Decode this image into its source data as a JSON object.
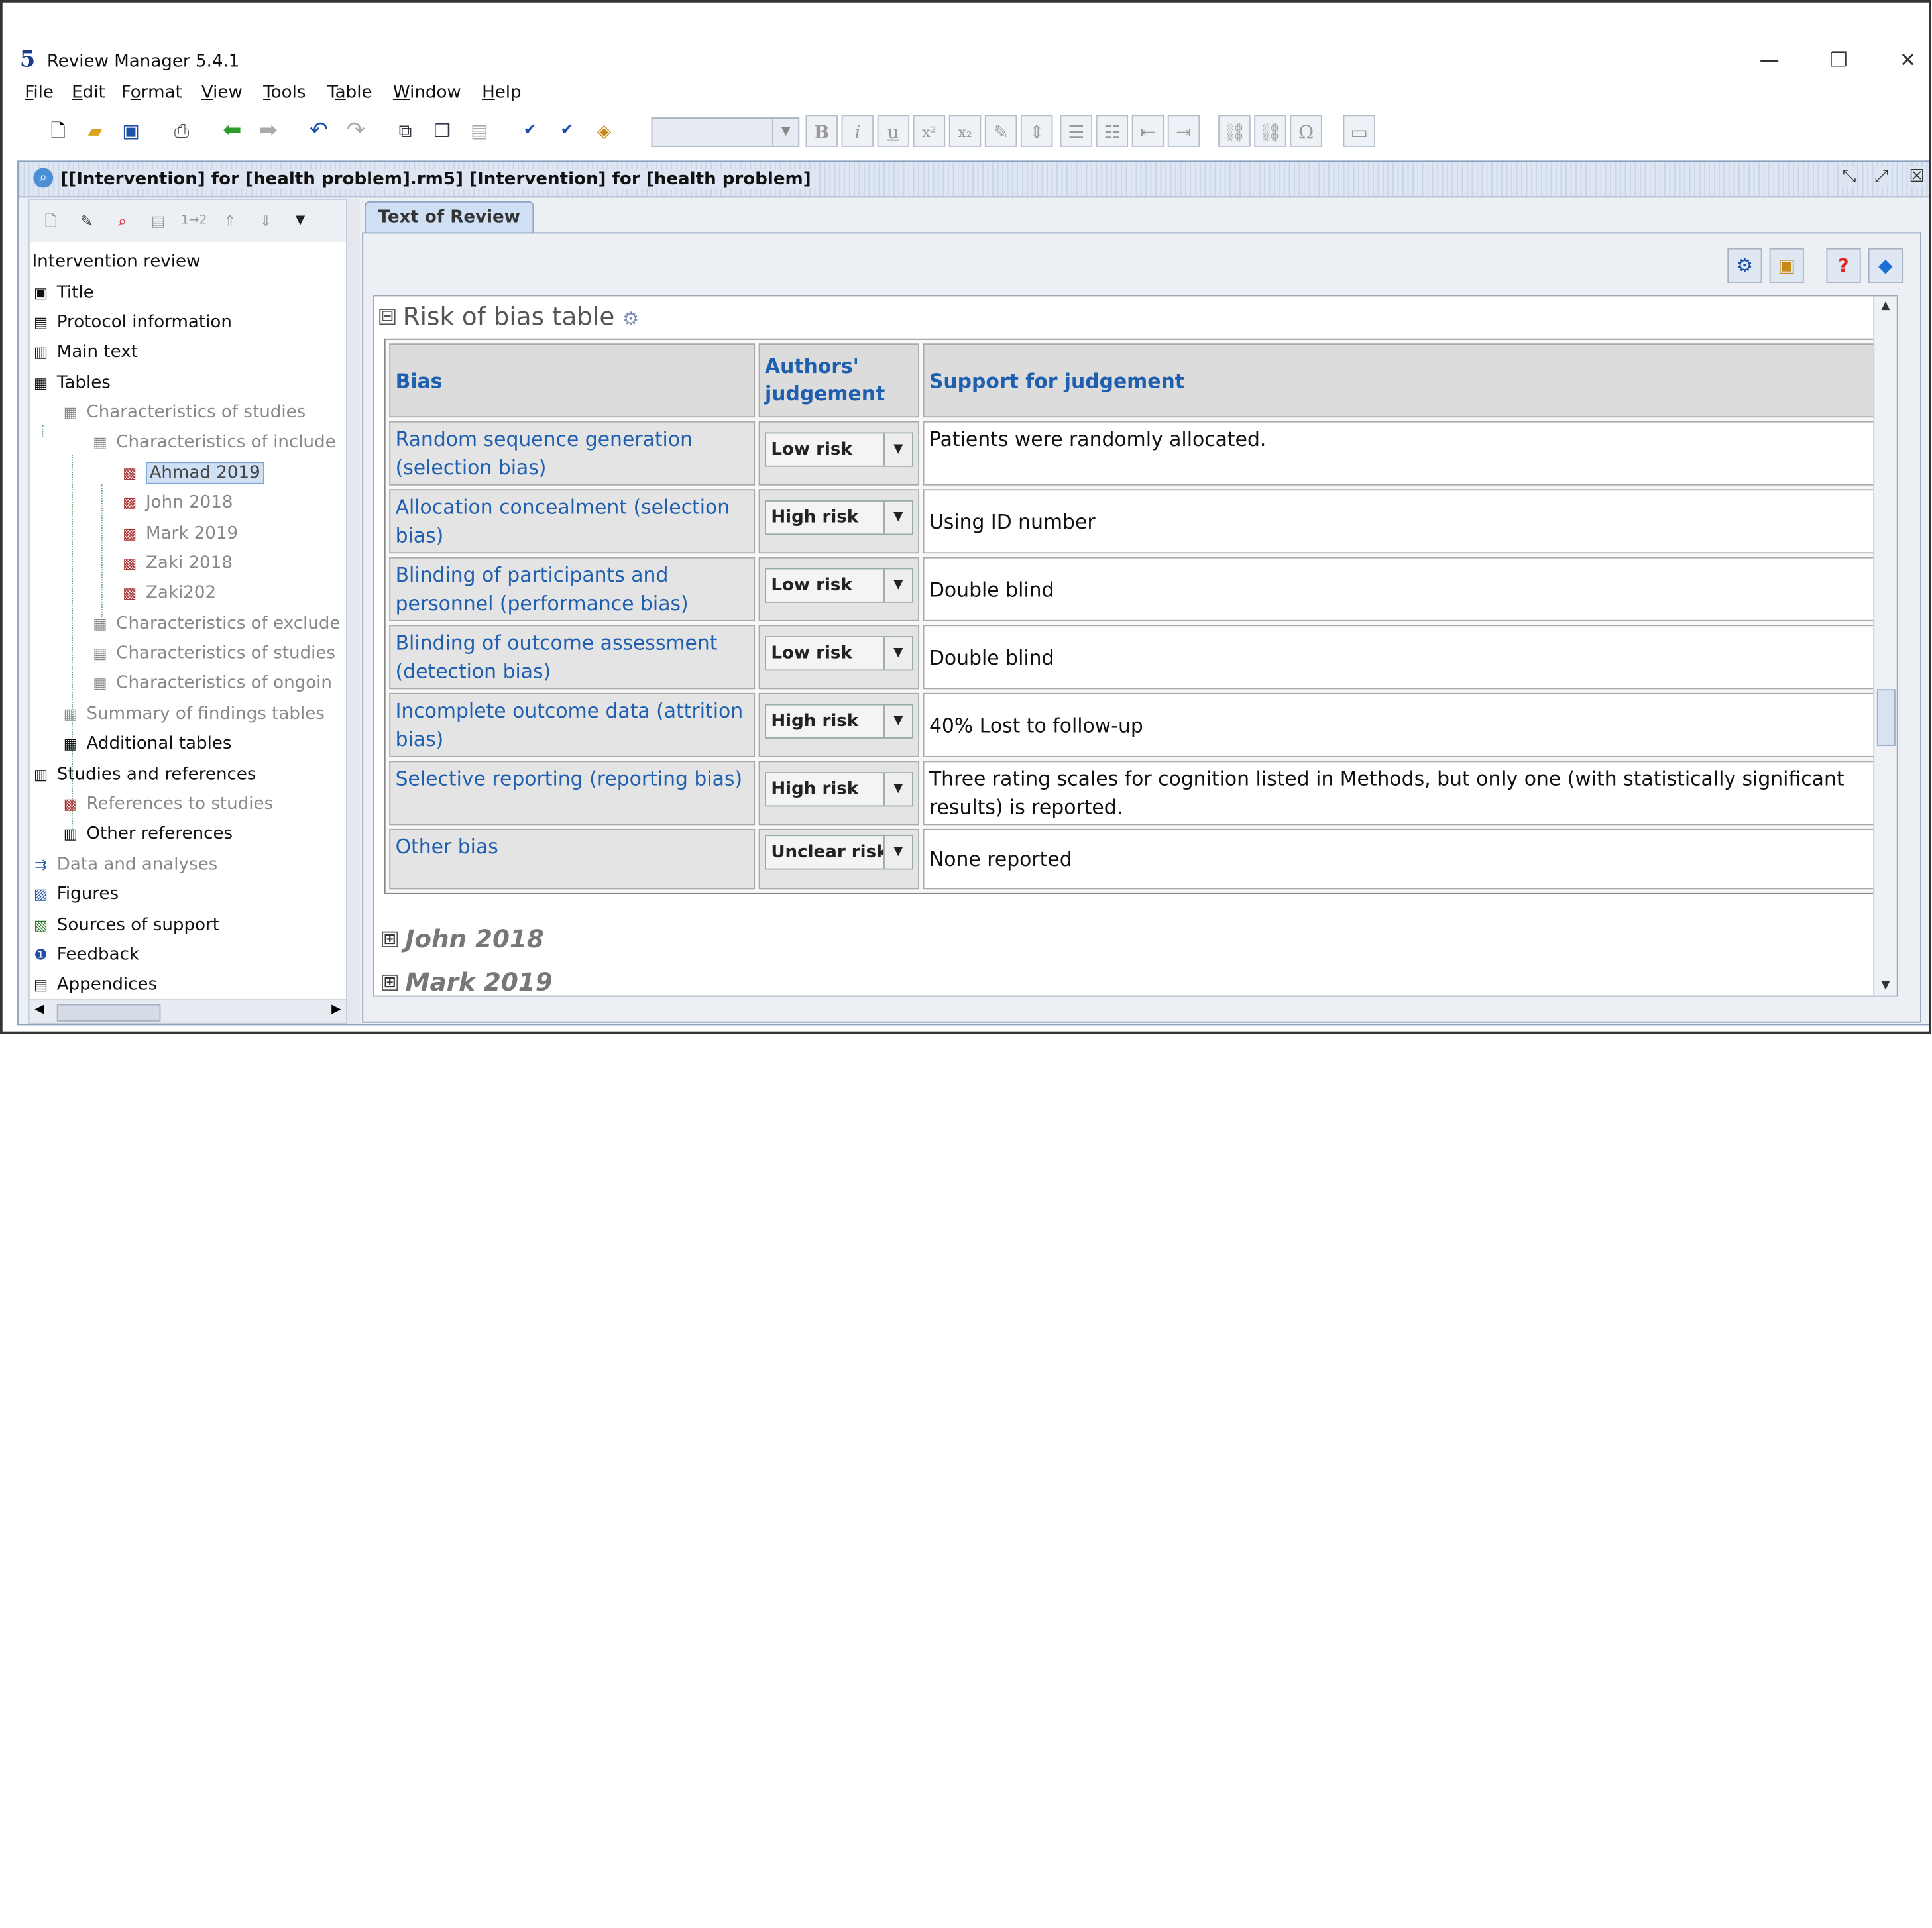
{
  "app": {
    "logo": "5",
    "title": "Review Manager 5.4.1",
    "window_controls": [
      "—",
      "❐",
      "✕"
    ]
  },
  "menu": [
    {
      "pre": "",
      "u": "F",
      "post": "ile"
    },
    {
      "pre": "",
      "u": "E",
      "post": "dit"
    },
    {
      "pre": "F",
      "u": "o",
      "post": "rmat"
    },
    {
      "pre": "",
      "u": "V",
      "post": "iew"
    },
    {
      "pre": "",
      "u": "T",
      "post": "ools"
    },
    {
      "pre": "T",
      "u": "a",
      "post": "ble"
    },
    {
      "pre": "",
      "u": "W",
      "post": "indow"
    },
    {
      "pre": "",
      "u": "H",
      "post": "elp"
    }
  ],
  "toolbar": {
    "format_glyphs": [
      "B",
      "i",
      "u",
      "x²",
      "x₂"
    ],
    "special_char": "Ω",
    "icons": [
      "new-document-icon",
      "open-folder-icon",
      "save-icon",
      "print-icon",
      "back-arrow-icon",
      "forward-arrow-icon",
      "undo-icon",
      "redo-icon",
      "copy-icon",
      "paste-icon",
      "clipboard-icon",
      "spellcheck-icon",
      "spellcheck-abc-icon",
      "validate-icon"
    ]
  },
  "document": {
    "title": "[[Intervention] for [health problem].rm5] [Intervention] for [health problem]",
    "title_icon": "document-icon"
  },
  "outline": {
    "toolbar_label": "1→2",
    "root": "Intervention review",
    "items": [
      {
        "label": "Title",
        "icon": "title-icon",
        "glyph": "▣"
      },
      {
        "label": "Protocol information",
        "icon": "protocol-icon",
        "glyph": "▤"
      },
      {
        "label": "Main text",
        "icon": "main-text-icon",
        "glyph": "▥"
      },
      {
        "label": "Tables",
        "icon": "table-icon",
        "glyph": "▦"
      },
      {
        "label": "Characteristics of studies",
        "icon": "table-icon",
        "glyph": "▦"
      },
      {
        "label": "Characteristics of include",
        "icon": "table-icon",
        "glyph": "▦"
      },
      {
        "label": "Ahmad 2019",
        "icon": "study-icon",
        "glyph": "▩"
      },
      {
        "label": "John 2018",
        "icon": "study-icon",
        "glyph": "▩"
      },
      {
        "label": "Mark 2019",
        "icon": "study-icon",
        "glyph": "▩"
      },
      {
        "label": "Zaki 2018",
        "icon": "study-icon",
        "glyph": "▩"
      },
      {
        "label": "Zaki202",
        "icon": "study-icon",
        "glyph": "▩"
      },
      {
        "label": "Characteristics of exclude",
        "icon": "table-icon",
        "glyph": "▦"
      },
      {
        "label": "Characteristics of studies",
        "icon": "table-icon",
        "glyph": "▦"
      },
      {
        "label": "Characteristics of ongoin",
        "icon": "table-icon",
        "glyph": "▦"
      },
      {
        "label": "Summary of findings tables",
        "icon": "table-icon",
        "glyph": "▦"
      },
      {
        "label": "Additional tables",
        "icon": "table-icon",
        "glyph": "▦"
      },
      {
        "label": "Studies and references",
        "icon": "book-icon",
        "glyph": "▥"
      },
      {
        "label": "References to studies",
        "icon": "study-icon",
        "glyph": "▩"
      },
      {
        "label": "Other references",
        "icon": "book-icon",
        "glyph": "▥"
      },
      {
        "label": "Data and analyses",
        "icon": "analysis-icon",
        "glyph": "⇉"
      },
      {
        "label": "Figures",
        "icon": "figure-icon",
        "glyph": "▨"
      },
      {
        "label": "Sources of support",
        "icon": "support-icon",
        "glyph": "▧"
      },
      {
        "label": "Feedback",
        "icon": "feedback-icon",
        "glyph": "❶"
      },
      {
        "label": "Appendices",
        "icon": "appendix-icon",
        "glyph": "▤"
      }
    ]
  },
  "tab": {
    "label": "Text of Review"
  },
  "section": {
    "title": "Risk of bias table",
    "collapse_glyph": "⊟"
  },
  "rob_table": {
    "headers": [
      "Bias",
      "Authors' judgement",
      "Support for judgement"
    ],
    "rows": [
      {
        "bias": "Random sequence generation (selection bias)",
        "judgement": "Low risk",
        "support": "Patients were randomly allocated."
      },
      {
        "bias": "Allocation concealment (selection bias)",
        "judgement": "High risk",
        "support": "Using ID number"
      },
      {
        "bias": "Blinding of participants and personnel (performance bias)",
        "judgement": "Low risk",
        "support": "Double blind"
      },
      {
        "bias": "Blinding of outcome assessment (detection bias)",
        "judgement": "Low risk",
        "support": "Double blind"
      },
      {
        "bias": "Incomplete outcome data (attrition bias)",
        "judgement": "High risk",
        "support": "40% Lost to follow-up"
      },
      {
        "bias": "Selective reporting (reporting bias)",
        "judgement": "High risk",
        "support": "Three rating scales for cognition listed in Methods, but only one (with statistically significant results) is reported."
      },
      {
        "bias": "Other bias",
        "judgement": "Unclear risk",
        "support": "None reported"
      }
    ]
  },
  "studies_below": [
    "John 2018",
    "Mark 2019"
  ],
  "expand_glyph": "⊞",
  "colors": {
    "link_blue": "#1f5fb0",
    "header_gray": "#dcdcdc",
    "pane_bg": "#eceff4"
  }
}
